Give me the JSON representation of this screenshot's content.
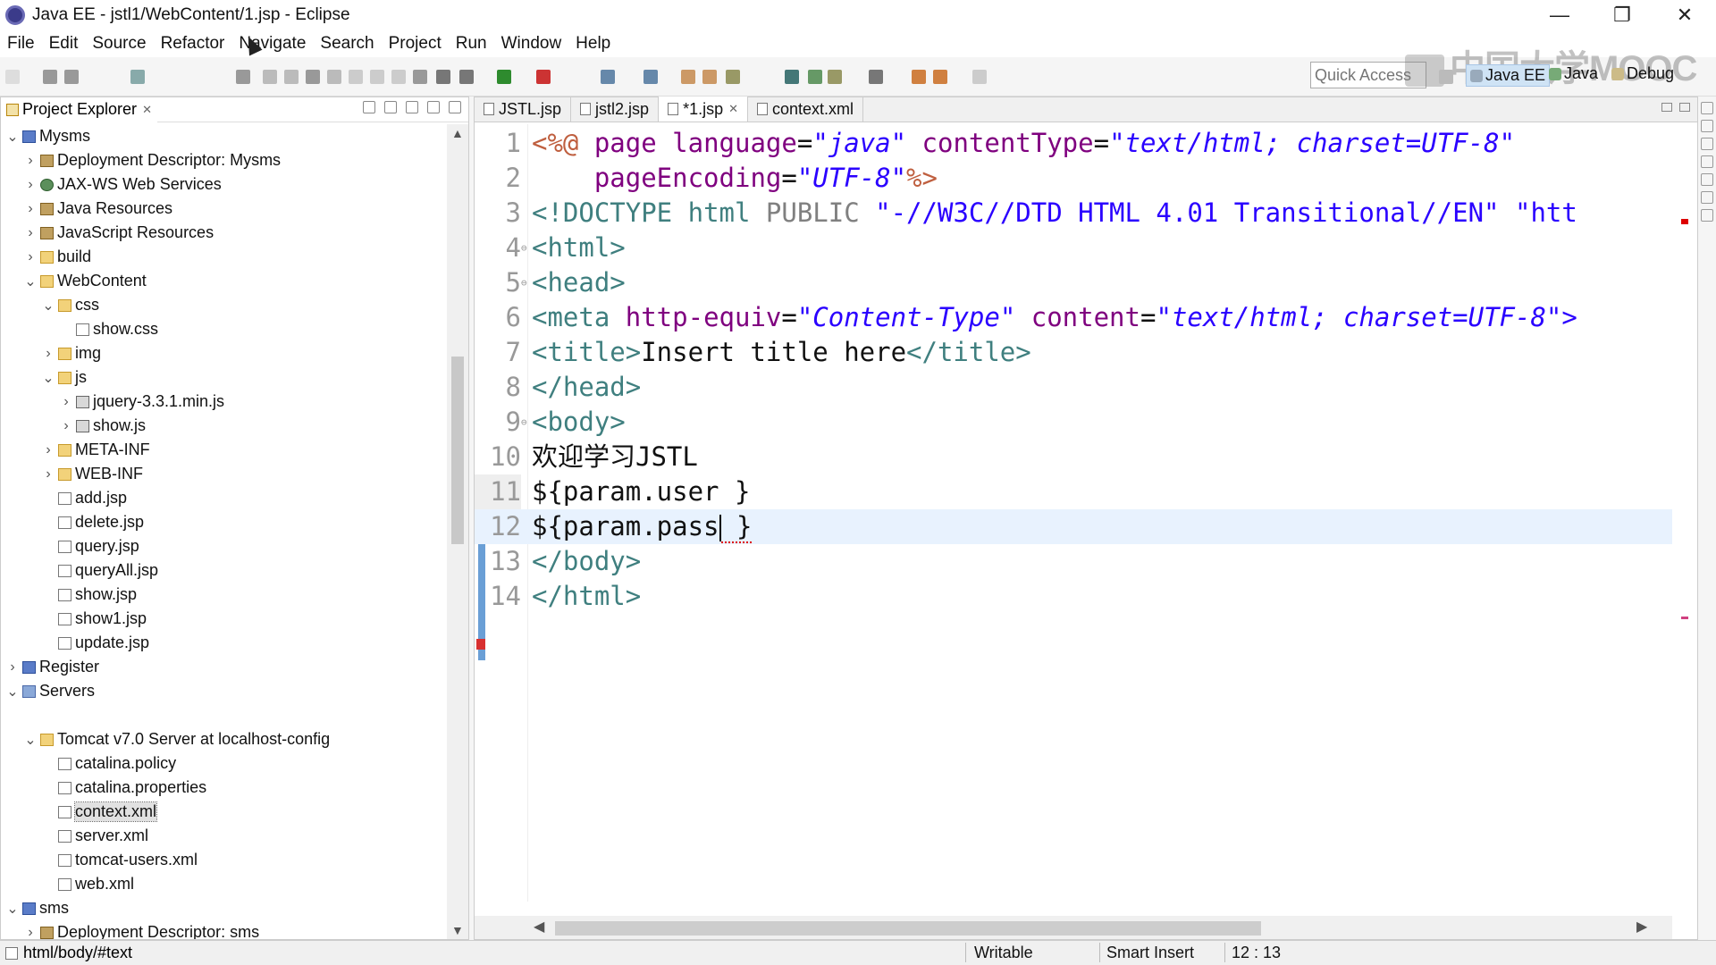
{
  "window": {
    "title": "Java EE - jstl1/WebContent/1.jsp - Eclipse",
    "minimize": "—",
    "maximize": "❐",
    "close": "✕"
  },
  "menu": [
    "File",
    "Edit",
    "Source",
    "Refactor",
    "Navigate",
    "Search",
    "Project",
    "Run",
    "Window",
    "Help"
  ],
  "toolbar": {
    "quick_access_placeholder": "Quick Access",
    "perspectives": [
      {
        "label": "Java EE",
        "active": true,
        "icon": "java-ee-perspective-icon"
      },
      {
        "label": "Java",
        "active": false,
        "icon": "java-perspective-icon"
      },
      {
        "label": "Debug",
        "active": false,
        "icon": "debug-perspective-icon"
      }
    ]
  },
  "watermark": {
    "text": "中国大学MOOC"
  },
  "explorer": {
    "title": "Project Explorer",
    "items": [
      {
        "label": "Mysms",
        "depth": 0,
        "arrow": "v",
        "icon": "project"
      },
      {
        "label": "Deployment Descriptor: Mysms",
        "depth": 1,
        "arrow": ">",
        "icon": "jar"
      },
      {
        "label": "JAX-WS Web Services",
        "depth": 1,
        "arrow": ">",
        "icon": "globe"
      },
      {
        "label": "Java Resources",
        "depth": 1,
        "arrow": ">",
        "icon": "jar"
      },
      {
        "label": "JavaScript Resources",
        "depth": 1,
        "arrow": ">",
        "icon": "jar"
      },
      {
        "label": "build",
        "depth": 1,
        "arrow": ">",
        "icon": "folder"
      },
      {
        "label": "WebContent",
        "depth": 1,
        "arrow": "v",
        "icon": "folder"
      },
      {
        "label": "css",
        "depth": 2,
        "arrow": "v",
        "icon": "folder"
      },
      {
        "label": "show.css",
        "depth": 3,
        "arrow": "",
        "icon": "file"
      },
      {
        "label": "img",
        "depth": 2,
        "arrow": ">",
        "icon": "folder"
      },
      {
        "label": "js",
        "depth": 2,
        "arrow": "v",
        "icon": "folder"
      },
      {
        "label": "jquery-3.3.1.min.js",
        "depth": 3,
        "arrow": ">",
        "icon": "js"
      },
      {
        "label": "show.js",
        "depth": 3,
        "arrow": ">",
        "icon": "js"
      },
      {
        "label": "META-INF",
        "depth": 2,
        "arrow": ">",
        "icon": "folder"
      },
      {
        "label": "WEB-INF",
        "depth": 2,
        "arrow": ">",
        "icon": "folder"
      },
      {
        "label": "add.jsp",
        "depth": 2,
        "arrow": "",
        "icon": "file"
      },
      {
        "label": "delete.jsp",
        "depth": 2,
        "arrow": "",
        "icon": "file"
      },
      {
        "label": "query.jsp",
        "depth": 2,
        "arrow": "",
        "icon": "file"
      },
      {
        "label": "queryAll.jsp",
        "depth": 2,
        "arrow": "",
        "icon": "file"
      },
      {
        "label": "show.jsp",
        "depth": 2,
        "arrow": "",
        "icon": "file"
      },
      {
        "label": "show1.jsp",
        "depth": 2,
        "arrow": "",
        "icon": "file"
      },
      {
        "label": "update.jsp",
        "depth": 2,
        "arrow": "",
        "icon": "file"
      },
      {
        "label": "Register",
        "depth": 0,
        "arrow": ">",
        "icon": "project"
      },
      {
        "label": "Servers",
        "depth": 0,
        "arrow": "v",
        "icon": "server"
      },
      {
        "label": "",
        "depth": 0,
        "arrow": "",
        "icon": "none"
      },
      {
        "label": "Tomcat v7.0 Server at localhost-config",
        "depth": 1,
        "arrow": "v",
        "icon": "folder"
      },
      {
        "label": "catalina.policy",
        "depth": 2,
        "arrow": "",
        "icon": "file"
      },
      {
        "label": "catalina.properties",
        "depth": 2,
        "arrow": "",
        "icon": "file"
      },
      {
        "label": "context.xml",
        "depth": 2,
        "arrow": "",
        "icon": "xml",
        "selected": true
      },
      {
        "label": "server.xml",
        "depth": 2,
        "arrow": "",
        "icon": "xml"
      },
      {
        "label": "tomcat-users.xml",
        "depth": 2,
        "arrow": "",
        "icon": "xml"
      },
      {
        "label": "web.xml",
        "depth": 2,
        "arrow": "",
        "icon": "xml"
      },
      {
        "label": "sms",
        "depth": 0,
        "arrow": "v",
        "icon": "project"
      },
      {
        "label": "Deployment Descriptor: sms",
        "depth": 1,
        "arrow": ">",
        "icon": "jar"
      }
    ]
  },
  "editor": {
    "tabs": [
      {
        "label": "JSTL.jsp",
        "active": false
      },
      {
        "label": "jstl2.jsp",
        "active": false
      },
      {
        "label": "*1.jsp",
        "active": true,
        "closable": true
      },
      {
        "label": "context.xml",
        "active": false
      }
    ],
    "lines": [
      {
        "n": "1",
        "segs": [
          [
            "jsp",
            "<%@ "
          ],
          [
            "attr",
            "page "
          ],
          [
            "attr",
            "language"
          ],
          [
            "txt",
            "="
          ],
          [
            "str",
            "\"java\""
          ],
          [
            "txt",
            " "
          ],
          [
            "attr",
            "contentType"
          ],
          [
            "txt",
            "="
          ],
          [
            "str",
            "\"text/html; charset=UTF-8\""
          ]
        ]
      },
      {
        "n": "2",
        "segs": [
          [
            "txt",
            "    "
          ],
          [
            "attr",
            "pageEncoding"
          ],
          [
            "txt",
            "="
          ],
          [
            "str",
            "\"UTF-8\""
          ],
          [
            "jsp",
            "%>"
          ]
        ]
      },
      {
        "n": "3",
        "segs": [
          [
            "tag",
            "<!DOCTYPE "
          ],
          [
            "tag",
            "html "
          ],
          [
            "doc",
            "PUBLIC "
          ],
          [
            "str2",
            "\"-//W3C//DTD HTML 4.01 Transitional//EN\" \"htt"
          ]
        ]
      },
      {
        "n": "4",
        "fold": true,
        "segs": [
          [
            "tag",
            "<html>"
          ]
        ]
      },
      {
        "n": "5",
        "fold": true,
        "segs": [
          [
            "tag",
            "<head>"
          ]
        ]
      },
      {
        "n": "6",
        "segs": [
          [
            "tag",
            "<meta "
          ],
          [
            "attr",
            "http-equiv"
          ],
          [
            "txt",
            "="
          ],
          [
            "str",
            "\"Content-Type\""
          ],
          [
            "txt",
            " "
          ],
          [
            "attr",
            "content"
          ],
          [
            "txt",
            "="
          ],
          [
            "str",
            "\"text/html; charset=UTF-8\">"
          ]
        ]
      },
      {
        "n": "7",
        "segs": [
          [
            "tag",
            "<title>"
          ],
          [
            "txt",
            "Insert title here"
          ],
          [
            "tag",
            "</title>"
          ]
        ]
      },
      {
        "n": "8",
        "segs": [
          [
            "tag",
            "</head>"
          ]
        ]
      },
      {
        "n": "9",
        "fold": true,
        "segs": [
          [
            "tag",
            "<body>"
          ]
        ]
      },
      {
        "n": "10",
        "segs": [
          [
            "txt",
            "欢迎学习JSTL"
          ]
        ]
      },
      {
        "n": "11",
        "hi": true,
        "segs": [
          [
            "txt",
            "${param.user }"
          ]
        ]
      },
      {
        "n": "12",
        "current": true,
        "segs": [
          [
            "txt",
            "${param.pass"
          ],
          [
            "caret",
            ""
          ],
          [
            "sq",
            " }"
          ]
        ]
      },
      {
        "n": "13",
        "segs": [
          [
            "tag",
            "</body>"
          ]
        ]
      },
      {
        "n": "14",
        "segs": [
          [
            "tag",
            "</html>"
          ]
        ]
      }
    ]
  },
  "status": {
    "path": "html/body/#text",
    "mode": "Writable",
    "insert": "Smart Insert",
    "position": "12 : 13"
  },
  "colors": {
    "tag": "#3f7f7f",
    "attr": "#7f007f",
    "string": "#2a00ff",
    "jsp": "#bf5f3f",
    "current_line": "#e8f2fe"
  }
}
